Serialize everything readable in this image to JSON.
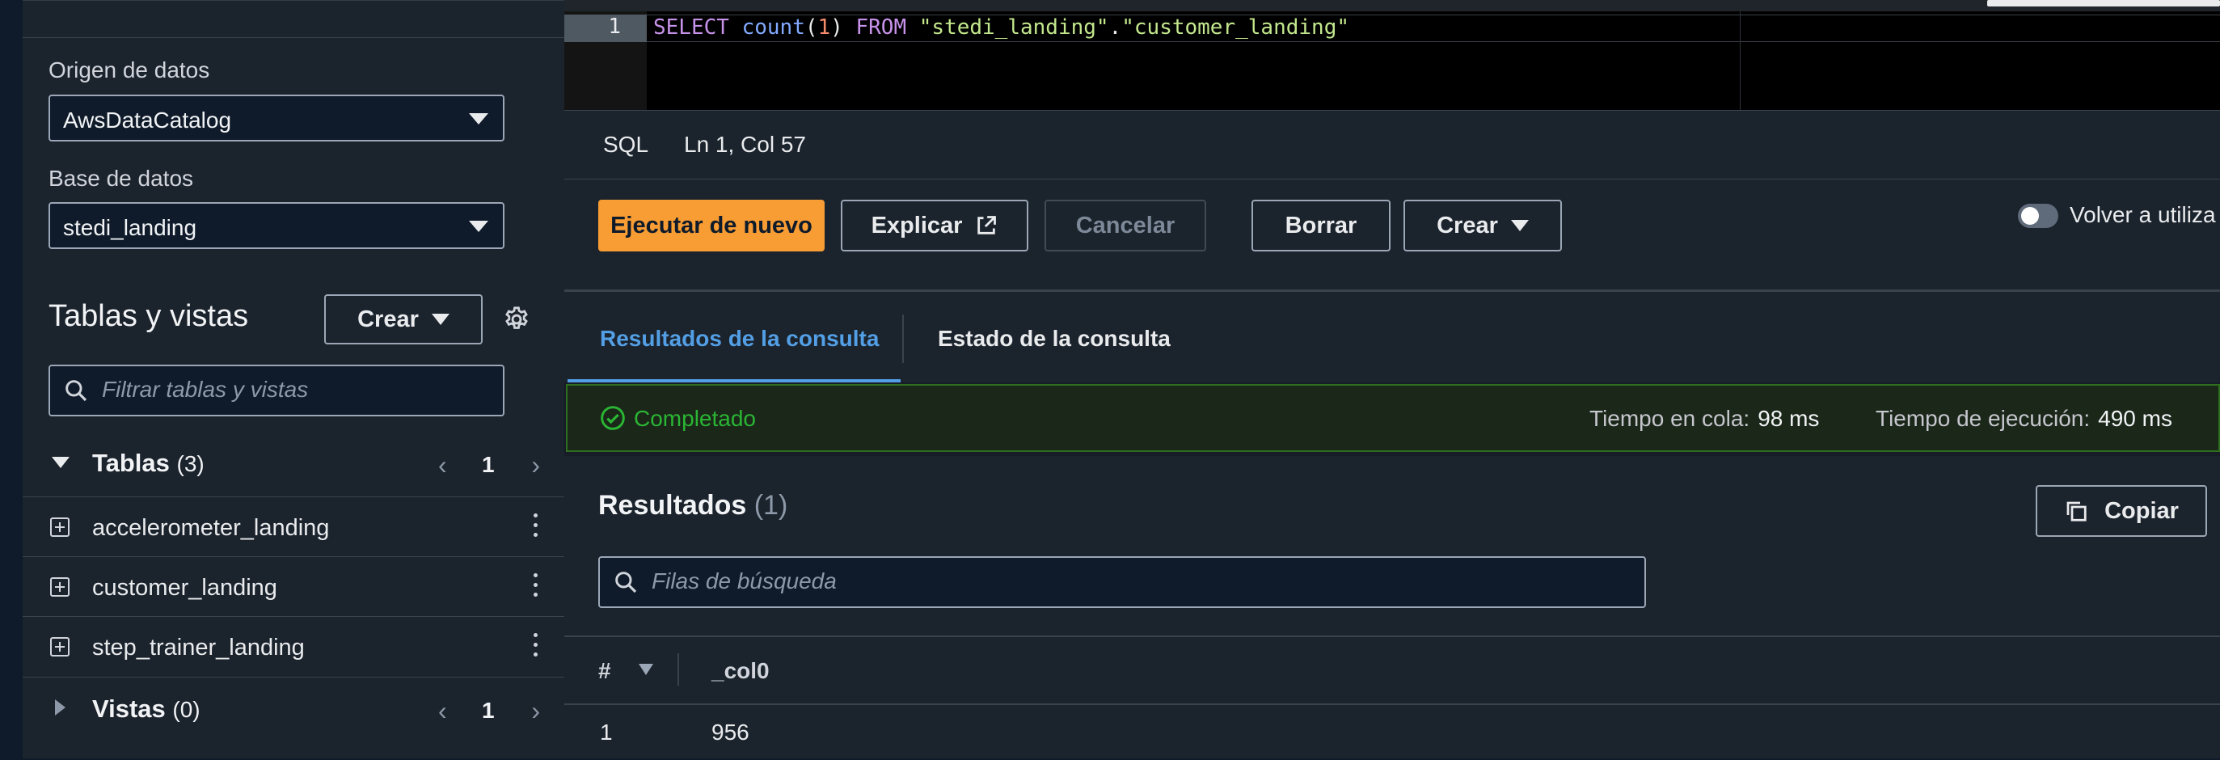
{
  "left_panel": {
    "data_source_label": "Origen de datos",
    "data_source_value": "AwsDataCatalog",
    "database_label": "Base de datos",
    "database_value": "stedi_landing",
    "tables_views_title": "Tablas y vistas",
    "create_label": "Crear",
    "filter_placeholder": "Filtrar tablas y vistas",
    "tables": {
      "title": "Tablas",
      "count": "(3)",
      "page": "1",
      "items": [
        "accelerometer_landing",
        "customer_landing",
        "step_trainer_landing"
      ]
    },
    "views": {
      "title": "Vistas",
      "count": "(0)",
      "page": "1"
    }
  },
  "editor": {
    "line_number": "1",
    "code_tokens": [
      "SELECT",
      "count",
      "(",
      "1",
      ")",
      "FROM",
      "\"stedi_landing\"",
      ".",
      "\"customer_landing\""
    ]
  },
  "status_bar": {
    "language": "SQL",
    "cursor": "Ln 1, Col 57"
  },
  "actions": {
    "run_again": "Ejecutar de nuevo",
    "explain": "Explicar",
    "cancel": "Cancelar",
    "clear": "Borrar",
    "create": "Crear",
    "toggle_label": "Volver a utiliza"
  },
  "tabs": {
    "results": "Resultados de la consulta",
    "status": "Estado de la consulta"
  },
  "banner": {
    "status": "Completado",
    "queue_label": "Tiempo en cola:",
    "queue_value": "98 ms",
    "exec_label": "Tiempo de ejecución:",
    "exec_value": "490 ms"
  },
  "results": {
    "title": "Resultados",
    "count": "(1)",
    "copy_label": "Copiar",
    "search_placeholder": "Filas de búsqueda",
    "columns": [
      "#",
      "_col0"
    ],
    "rows": [
      [
        "1",
        "956"
      ]
    ]
  },
  "colors": {
    "accent": "#f89c34",
    "link": "#539fe5",
    "success": "#2bb534"
  }
}
